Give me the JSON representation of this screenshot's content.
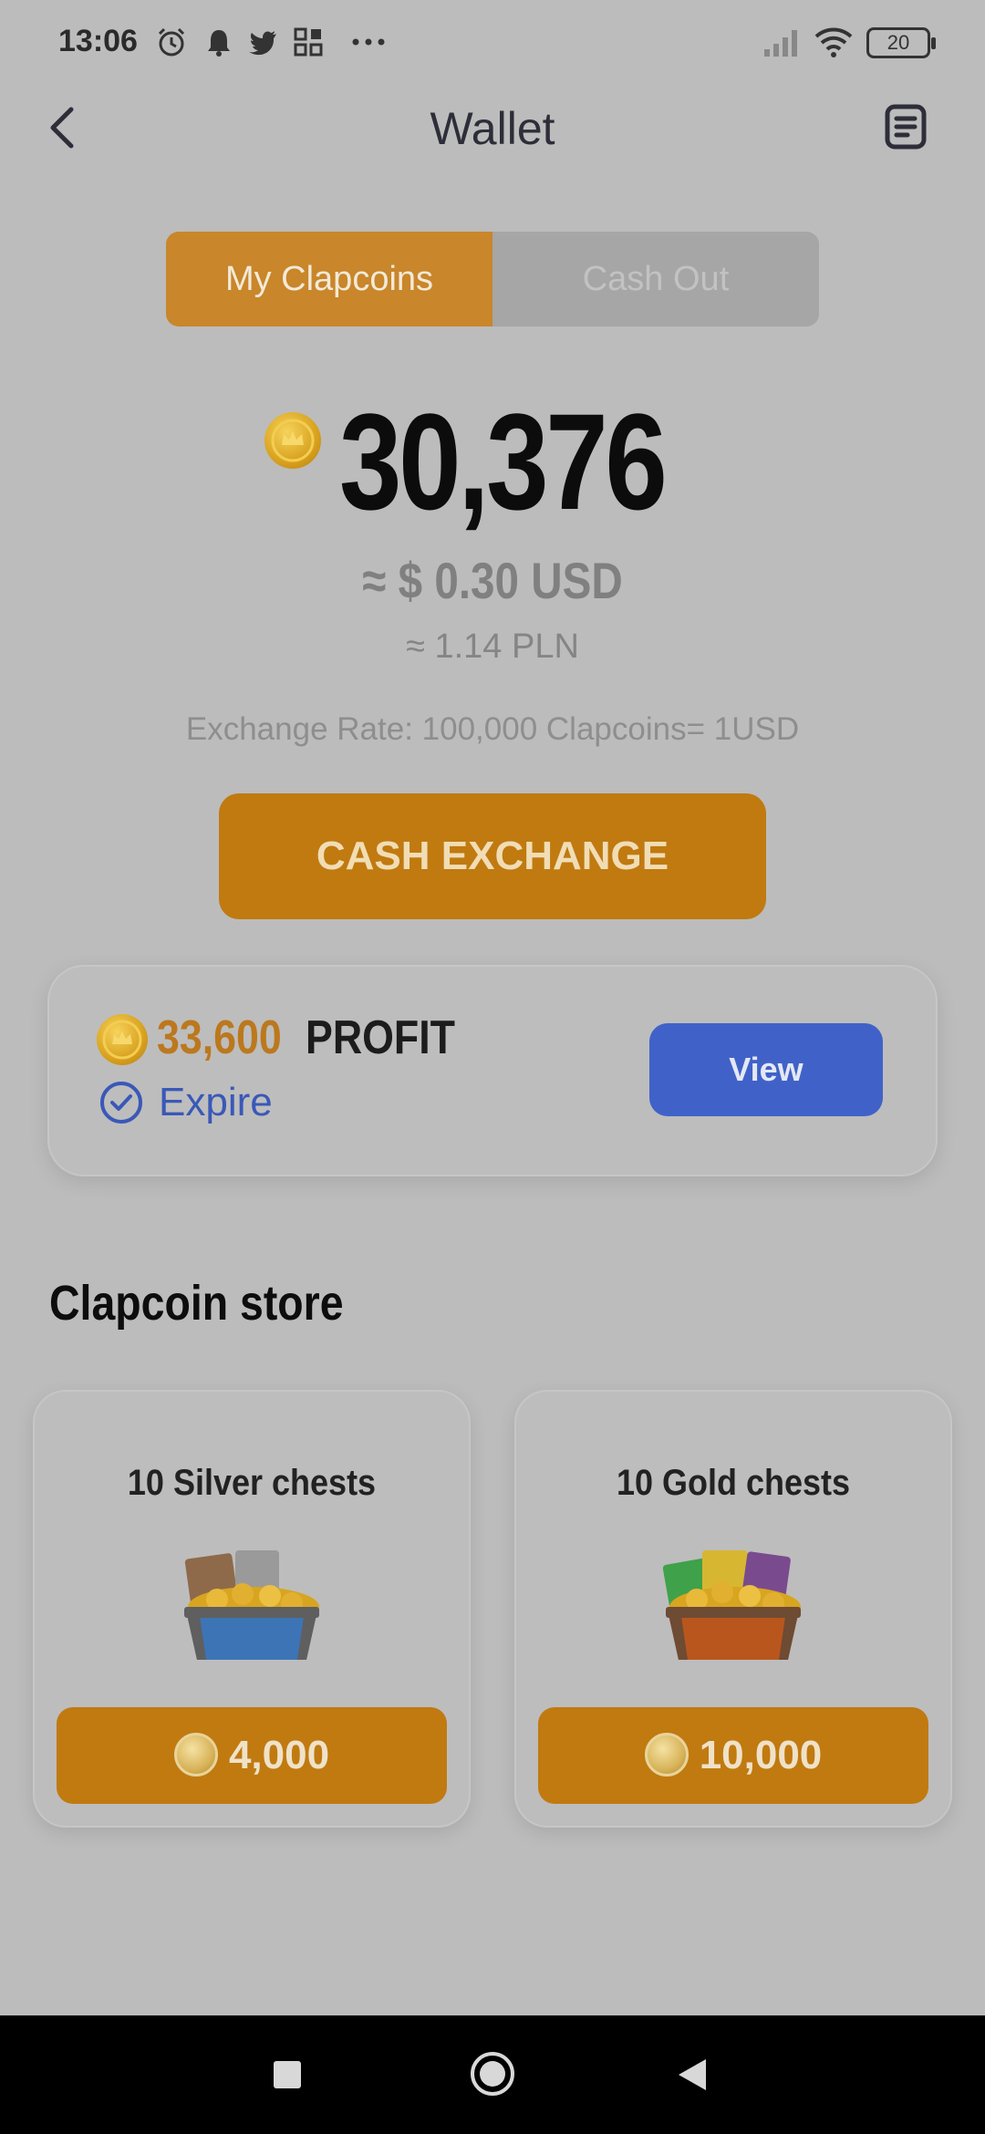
{
  "status_bar": {
    "time": "13:06",
    "battery": "20",
    "icons": [
      "alarm-icon",
      "notification-bell-icon",
      "twitter-icon",
      "app-grid-icon",
      "more-icon",
      "signal-icon",
      "wifi-icon",
      "battery-icon"
    ]
  },
  "header": {
    "title": "Wallet",
    "back_icon": "chevron-left-icon",
    "history_icon": "document-icon"
  },
  "tabs": [
    {
      "label": "My Clapcoins",
      "active": true
    },
    {
      "label": "Cash Out",
      "active": false
    }
  ],
  "balance": {
    "coins": "30,376",
    "usd": "≈ $ 0.30 USD",
    "pln": "≈ 1.14 PLN",
    "exchange_rate": "Exchange Rate: 100,000 Clapcoins= 1USD"
  },
  "cash_exchange_label": "CASH EXCHANGE",
  "profit_card": {
    "amount": "33,600",
    "label": "PROFIT",
    "expire": "Expire",
    "view_label": "View"
  },
  "store": {
    "title": "Clapcoin store",
    "items": [
      {
        "name": "10 Silver chests",
        "price": "4,000",
        "chest_color": "#3d74b6"
      },
      {
        "name": "10 Gold chests",
        "price": "10,000",
        "chest_color": "#b9561e"
      }
    ]
  },
  "colors": {
    "accent": "#c07a10",
    "view_button": "#4062c8",
    "background": "#bcbcbc"
  }
}
